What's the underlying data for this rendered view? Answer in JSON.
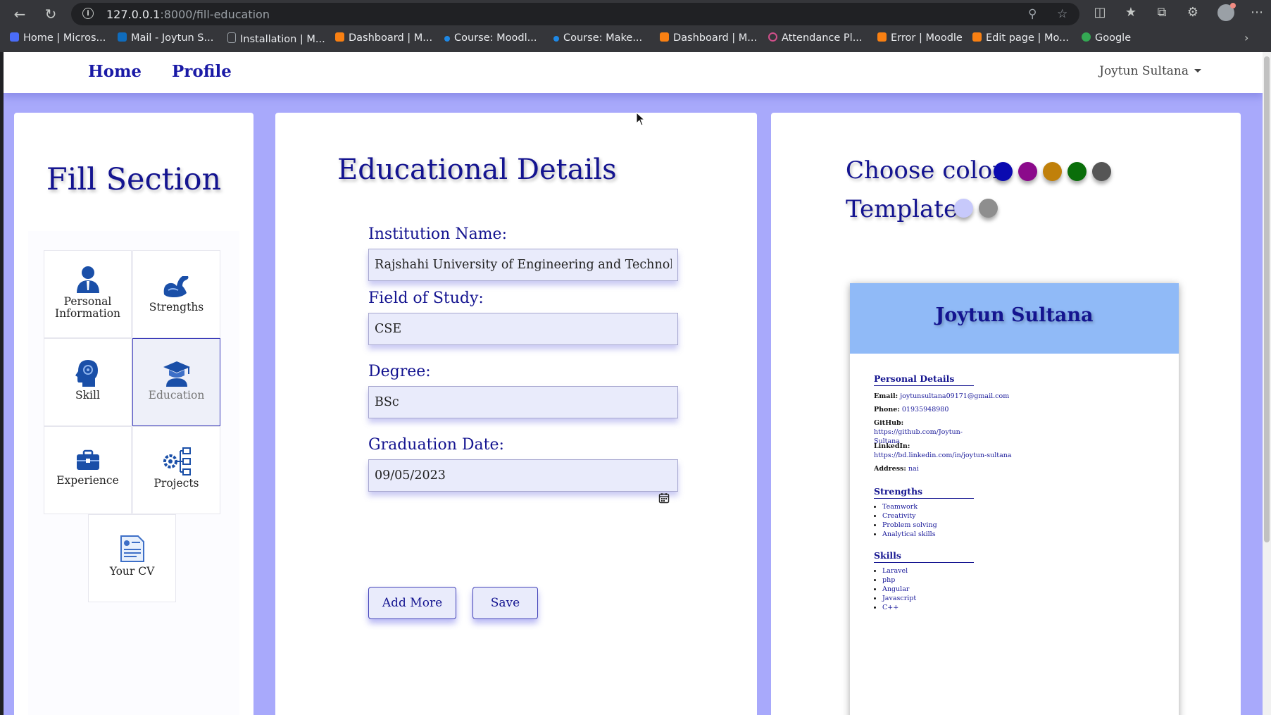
{
  "browser": {
    "url_host": "127.0.0.1",
    "url_rest": ":8000/fill-education",
    "bookmarks": [
      {
        "label": "Home | Micros...",
        "color": "#4a6cf7"
      },
      {
        "label": "Mail - Joytun S...",
        "color": "#0f6cbd"
      },
      {
        "label": "Installation | M...",
        "color": "#9aa0a6"
      },
      {
        "label": "Dashboard | M...",
        "color": "#f98012"
      },
      {
        "label": "Course: Moodl...",
        "color": "#1e88e5"
      },
      {
        "label": "Course: Make...",
        "color": "#1e88e5"
      },
      {
        "label": "Dashboard | M...",
        "color": "#f98012"
      },
      {
        "label": "Attendance Pl...",
        "color": "#d14f8a"
      },
      {
        "label": "Error | Moodle",
        "color": "#f98012"
      },
      {
        "label": "Edit page | Mo...",
        "color": "#f98012"
      },
      {
        "label": "Google",
        "color": "#34a853"
      }
    ]
  },
  "nav": {
    "home": "Home",
    "profile": "Profile",
    "user": "Joytun Sultana"
  },
  "sidebar": {
    "title": "Fill Section",
    "tiles": [
      {
        "label": "Personal Information",
        "icon": "person-icon"
      },
      {
        "label": "Strengths",
        "icon": "strength-arm-icon"
      },
      {
        "label": "Skill",
        "icon": "brain-head-icon"
      },
      {
        "label": "Education",
        "icon": "graduation-icon",
        "active": true
      },
      {
        "label": "Experience",
        "icon": "briefcase-icon"
      },
      {
        "label": "Projects",
        "icon": "gear-network-icon"
      },
      {
        "label": "Your CV",
        "icon": "document-icon"
      }
    ]
  },
  "form": {
    "title": "Educational Details",
    "institution_label": "Institution Name:",
    "institution_value": "Rajshahi University of Engineering and Technology",
    "field_label": "Field of Study:",
    "field_value": "CSE",
    "degree_label": "Degree:",
    "degree_value": "BSc",
    "grad_label": "Graduation Date:",
    "grad_value": "09/05/2023",
    "add_more": "Add More",
    "save": "Save"
  },
  "customize": {
    "choose_color": "Choose color",
    "template": "Template",
    "colors": [
      "#0a0ab0",
      "#8b0a8b",
      "#c0800a",
      "#0a6e0a",
      "#555555"
    ],
    "templates": [
      "#c7c9fb",
      "#8e8e8e"
    ]
  },
  "cv": {
    "name": "Joytun Sultana",
    "personal_heading": "Personal Details",
    "email_label": "Email:",
    "email": "joytunsultana09171@gmail.com",
    "phone_label": "Phone:",
    "phone": "01935948980",
    "github_label": "GitHub:",
    "github": "https://github.com/Joytun-Sultana",
    "linkedin_label": "LinkedIn:",
    "linkedin": "https://bd.linkedin.com/in/joytun-sultana",
    "address_label": "Address:",
    "address": "nai",
    "strengths_heading": "Strengths",
    "strengths": [
      "Teamwork",
      "Creativity",
      "Problem solving",
      "Analytical skills"
    ],
    "skills_heading": "Skills",
    "skills": [
      "Laravel",
      "php",
      "Angular",
      "Javascript",
      "C++"
    ]
  }
}
